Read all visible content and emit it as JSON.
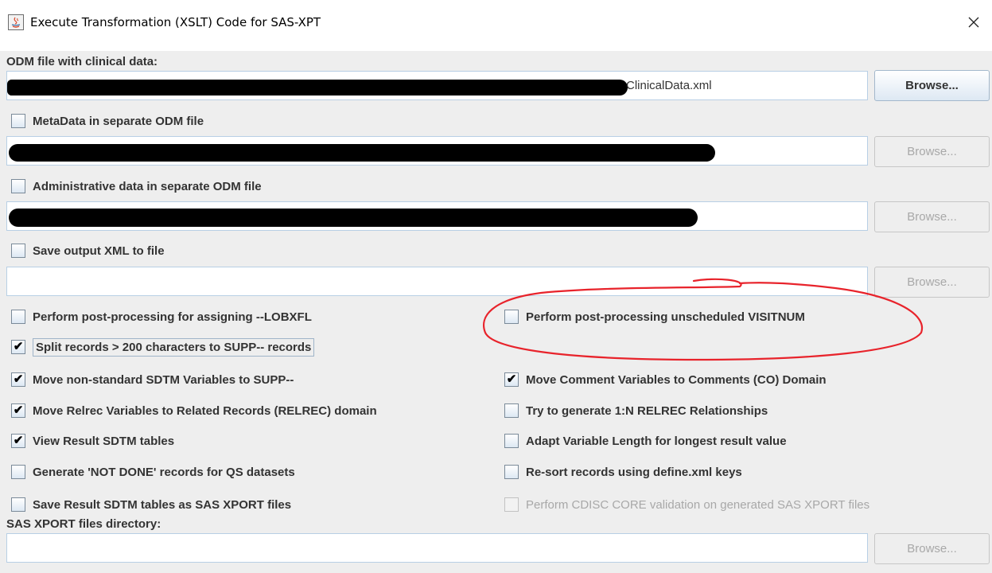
{
  "window": {
    "title": "Execute Transformation (XSLT) Code for SAS-XPT",
    "app_icon": "java-icon",
    "close_glyph": "✕"
  },
  "clinical": {
    "label": "ODM file with clinical data:",
    "value": "ClinicalData.xml",
    "browse": "Browse..."
  },
  "metadata": {
    "checkbox_label": "MetaData in separate ODM file",
    "checked": false,
    "browse": "Browse..."
  },
  "admin": {
    "checkbox_label": "Administrative data in separate ODM file",
    "checked": false,
    "browse": "Browse..."
  },
  "output": {
    "checkbox_label": "Save output XML to file",
    "checked": false,
    "value": "",
    "browse": "Browse..."
  },
  "options_left": [
    {
      "label": "Perform post-processing for assigning --LOBXFL",
      "checked": false
    },
    {
      "label": "Split records > 200 characters to SUPP-- records",
      "checked": true
    },
    {
      "label": "Move non-standard SDTM Variables to SUPP--",
      "checked": true
    },
    {
      "label": "Move Relrec Variables to Related Records (RELREC) domain",
      "checked": true
    },
    {
      "label": "View Result SDTM tables",
      "checked": true
    },
    {
      "label": "Generate 'NOT DONE' records for QS datasets",
      "checked": false
    },
    {
      "label": "Save Result SDTM tables as SAS XPORT files",
      "checked": false
    }
  ],
  "options_right": [
    {
      "label": "Perform post-processing unscheduled VISITNUM",
      "checked": false
    },
    {
      "label": "",
      "checked": false
    },
    {
      "label": "Move Comment Variables to Comments (CO) Domain",
      "checked": true
    },
    {
      "label": "Try to generate 1:N RELREC Relationships",
      "checked": false
    },
    {
      "label": "Adapt Variable Length for longest result value",
      "checked": false
    },
    {
      "label": "Re-sort records using define.xml keys",
      "checked": false
    },
    {
      "label": "Perform CDISC CORE validation on generated SAS XPORT files",
      "checked": false
    }
  ],
  "xport": {
    "label": "SAS XPORT files directory:",
    "value": "",
    "browse": "Browse..."
  },
  "colors": {
    "annotation": "#e8232b",
    "field_border": "#b8cfe5",
    "panel_bg": "#eeeeee"
  },
  "check_glyph": "✔"
}
